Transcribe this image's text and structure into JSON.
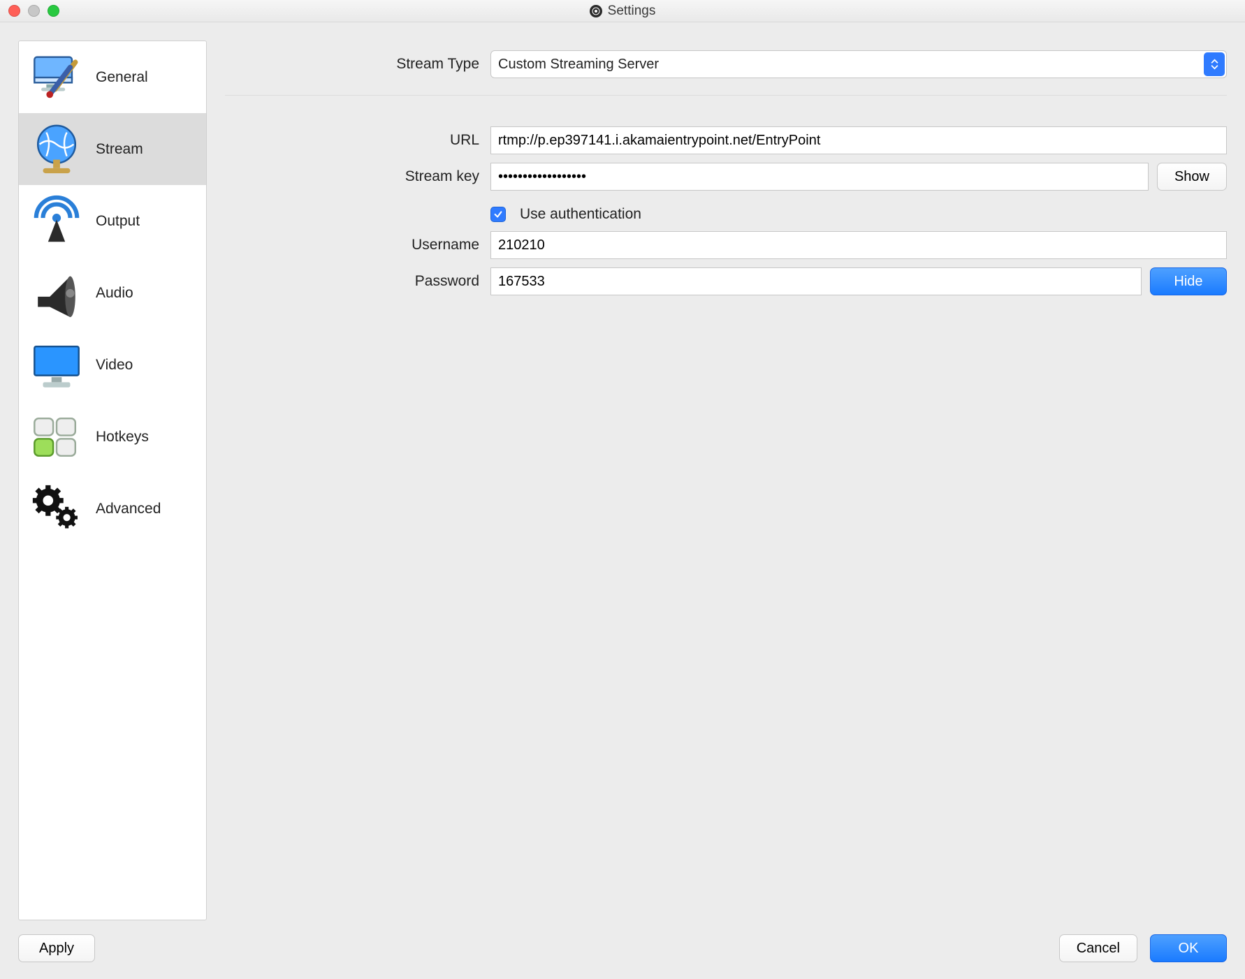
{
  "window": {
    "title": "Settings"
  },
  "sidebar": {
    "items": [
      {
        "label": "General"
      },
      {
        "label": "Stream"
      },
      {
        "label": "Output"
      },
      {
        "label": "Audio"
      },
      {
        "label": "Video"
      },
      {
        "label": "Hotkeys"
      },
      {
        "label": "Advanced"
      }
    ],
    "selected_index": 1
  },
  "form": {
    "stream_type_label": "Stream Type",
    "stream_type_value": "Custom Streaming Server",
    "url_label": "URL",
    "url_value": "rtmp://p.ep397141.i.akamaientrypoint.net/EntryPoint",
    "stream_key_label": "Stream key",
    "stream_key_value": "••••••••••••••••••",
    "show_button": "Show",
    "use_auth_label": "Use authentication",
    "use_auth_checked": true,
    "username_label": "Username",
    "username_value": "210210",
    "password_label": "Password",
    "password_value": "167533",
    "hide_button": "Hide"
  },
  "buttons": {
    "apply": "Apply",
    "cancel": "Cancel",
    "ok": "OK"
  }
}
